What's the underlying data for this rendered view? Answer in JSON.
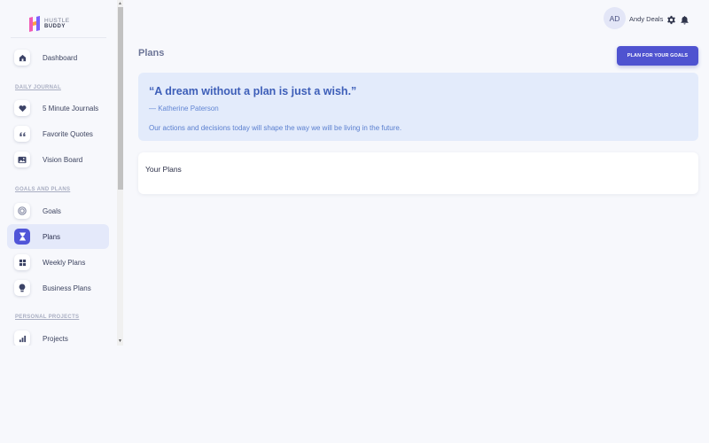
{
  "brand": {
    "line1": "HUSTLE",
    "line2": "BUDDY",
    "colors": {
      "h_left": "#f15bb5",
      "h_right": "#7b61ff"
    }
  },
  "sidebar": {
    "items": [
      {
        "label": "Dashboard",
        "icon": "house-icon"
      },
      {
        "label": "5 Minute Journals",
        "icon": "heart-icon"
      },
      {
        "label": "Favorite Quotes",
        "icon": "quote-icon"
      },
      {
        "label": "Vision Board",
        "icon": "image-icon"
      },
      {
        "label": "Goals",
        "icon": "target-icon"
      },
      {
        "label": "Plans",
        "icon": "hourglass-icon",
        "active": true
      },
      {
        "label": "Weekly Plans",
        "icon": "grid-icon"
      },
      {
        "label": "Business Plans",
        "icon": "lightbulb-icon"
      },
      {
        "label": "Projects",
        "icon": "bar-chart-icon"
      }
    ],
    "sections": {
      "daily_journal": "DAILY JOURNAL",
      "goals_and_plans": "GOALS AND PLANS",
      "personal_projects": "PERSONAL PROJECTS"
    }
  },
  "header": {
    "avatar_initials": "AD",
    "username": "Andy Deals",
    "icons": [
      "gear-icon",
      "bell-icon"
    ]
  },
  "main": {
    "title": "Plans",
    "primary_button": "PLAN FOR YOUR GOALS",
    "quote": {
      "text": "“A dream without a plan is just a wish.”",
      "author": "— Katherine Paterson",
      "subtext": "Our actions and decisions today will shape the way we will be living in the future."
    },
    "plans_card_title": "Your Plans"
  },
  "colors": {
    "accent": "#4f53d0",
    "active_nav_bg": "#e4e9fa",
    "quote_bg": "#e3ebfb",
    "quote_text": "#3d5eb8"
  }
}
